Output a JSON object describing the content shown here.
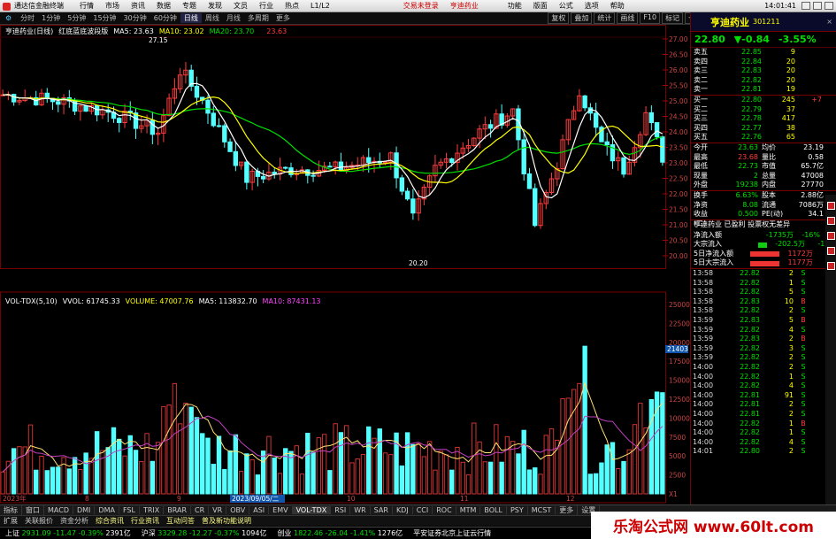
{
  "titlebar": {
    "app": "通达信金融终端",
    "menus": [
      "行情",
      "市场",
      "资讯",
      "数据",
      "专题",
      "发现",
      "文员",
      "行业",
      "热点",
      "L1/L2"
    ],
    "tray_login": "交易未登录",
    "stock": "亨迪药业",
    "right_menus": [
      "功能",
      "版面",
      "公式",
      "选项",
      "帮助"
    ],
    "clock": "14:01:41"
  },
  "toolbar2": {
    "items": [
      "分时",
      "1分钟",
      "5分钟",
      "15分钟",
      "30分钟",
      "60分钟",
      "日线",
      "周线",
      "月线",
      "多周期",
      "更多"
    ],
    "selected": "日线",
    "right": [
      "复权",
      "叠加",
      "统计",
      "画线",
      "F10",
      "标记",
      "-",
      "后退"
    ]
  },
  "kline_info": {
    "name": "亨迪药业(日线)",
    "indicator": "红底蓝底波段版",
    "ma5": "MA5: 23.63",
    "ma10": "MA10: 23.02",
    "ma20": "MA20: 23.70",
    "last": "23.63"
  },
  "vol_info": {
    "name": "VOL-TDX(5,10)",
    "vvol": "VVOL: 61745.33",
    "volume": "VOLUME: 47007.76",
    "ma5": "MA5: 113832.70",
    "ma10": "MA10: 87431.13"
  },
  "axis": {
    "price_ticks": [
      "27.00",
      "26.50",
      "26.00",
      "25.50",
      "25.00",
      "24.50",
      "24.00",
      "23.50",
      "23.00",
      "22.50",
      "22.00",
      "21.50",
      "21.00",
      "20.50",
      "20.00"
    ],
    "vol_ticks": [
      "25000",
      "22500",
      "20000",
      "17500",
      "15000",
      "12500",
      "10000",
      "7500",
      "5000",
      "2500",
      "X1"
    ],
    "vol_marker": "21403",
    "hi_label": "27.15",
    "lo_label": "20.20",
    "date_start": "2023年",
    "date_cursor": "2023/09/05/二",
    "months": [
      "8",
      "9",
      "10",
      "11",
      "12"
    ]
  },
  "quote": {
    "name": "亨迪药业",
    "code": "301211",
    "price": "22.80",
    "change": "▼-0.84",
    "pct": "-3.55%",
    "asks": [
      {
        "label": "卖五",
        "price": "22.85",
        "vol": "9"
      },
      {
        "label": "卖四",
        "price": "22.84",
        "vol": "20"
      },
      {
        "label": "卖三",
        "price": "22.83",
        "vol": "20"
      },
      {
        "label": "卖二",
        "price": "22.82",
        "vol": "20"
      },
      {
        "label": "卖一",
        "price": "22.81",
        "vol": "19"
      }
    ],
    "bids": [
      {
        "label": "买一",
        "price": "22.80",
        "vol": "245",
        "chg": "+7"
      },
      {
        "label": "买二",
        "price": "22.79",
        "vol": "37"
      },
      {
        "label": "买三",
        "price": "22.78",
        "vol": "417"
      },
      {
        "label": "买四",
        "price": "22.77",
        "vol": "38"
      },
      {
        "label": "买五",
        "price": "22.76",
        "vol": "65"
      }
    ],
    "stats": [
      {
        "a": "今开",
        "b": "23.63",
        "c": "均价",
        "d": "23.19"
      },
      {
        "a": "最高",
        "b": "23.68",
        "c": "量比",
        "d": "0.58"
      },
      {
        "a": "最低",
        "b": "22.73",
        "c": "市值",
        "d": "65.7亿"
      },
      {
        "a": "现量",
        "b": "2",
        "c": "总量",
        "d": "47008"
      },
      {
        "a": "外盘",
        "b": "19238",
        "c": "内盘",
        "d": "27770"
      }
    ],
    "stats2": [
      {
        "a": "换手",
        "b": "6.63%",
        "c": "股本",
        "d": "2.88亿"
      },
      {
        "a": "净资",
        "b": "8.08",
        "c": "流通",
        "d": "7086万"
      },
      {
        "a": "收益(二)",
        "b": "0.500",
        "c": "PE(动)",
        "d": "34.1"
      }
    ],
    "ticker": "亨迪药业 已盈利 投票权无差异",
    "flows": [
      {
        "label": "净流入额",
        "bar": 0,
        "val": "-1735万",
        "pct": "-16%",
        "cls": "grn"
      },
      {
        "label": "大宗流入",
        "bar": 10,
        "val": "-202.5万",
        "pct": "-1%",
        "cls": "grn"
      },
      {
        "label": "5日净流入额",
        "bar": 38,
        "val": "1172万",
        "pct": "1%",
        "cls": "red"
      },
      {
        "label": "5日大宗流入",
        "bar": 38,
        "val": "1177万",
        "pct": "1%",
        "cls": "red"
      }
    ],
    "ticks": [
      {
        "t": "13:58",
        "p": "22.82",
        "v": "2",
        "s": "S"
      },
      {
        "t": "13:58",
        "p": "22.82",
        "v": "1",
        "s": "S"
      },
      {
        "t": "13:58",
        "p": "22.82",
        "v": "5",
        "s": "S"
      },
      {
        "t": "13:58",
        "p": "22.83",
        "v": "10",
        "s": "B"
      },
      {
        "t": "13:58",
        "p": "22.82",
        "v": "2",
        "s": "S"
      },
      {
        "t": "13:59",
        "p": "22.83",
        "v": "5",
        "s": "B"
      },
      {
        "t": "13:59",
        "p": "22.82",
        "v": "4",
        "s": "S"
      },
      {
        "t": "13:59",
        "p": "22.83",
        "v": "2",
        "s": "B"
      },
      {
        "t": "13:59",
        "p": "22.82",
        "v": "3",
        "s": "S"
      },
      {
        "t": "13:59",
        "p": "22.82",
        "v": "2",
        "s": "S"
      },
      {
        "t": "14:00",
        "p": "22.82",
        "v": "2",
        "s": "S"
      },
      {
        "t": "14:00",
        "p": "22.82",
        "v": "1",
        "s": "S"
      },
      {
        "t": "14:00",
        "p": "22.82",
        "v": "4",
        "s": "S"
      },
      {
        "t": "14:00",
        "p": "22.81",
        "v": "91",
        "s": "S"
      },
      {
        "t": "14:00",
        "p": "22.81",
        "v": "2",
        "s": "S"
      },
      {
        "t": "14:00",
        "p": "22.81",
        "v": "2",
        "s": "S"
      },
      {
        "t": "14:00",
        "p": "22.82",
        "v": "1",
        "s": "B"
      },
      {
        "t": "14:00",
        "p": "22.82",
        "v": "1",
        "s": "S"
      },
      {
        "t": "14:00",
        "p": "22.82",
        "v": "4",
        "s": "S"
      },
      {
        "t": "14:01",
        "p": "22.80",
        "v": "2",
        "s": "S"
      }
    ]
  },
  "tabs": [
    "指标",
    "窗口",
    "MACD",
    "DMI",
    "DMA",
    "FSL",
    "TRIX",
    "BRAR",
    "CR",
    "VR",
    "OBV",
    "ASI",
    "EMV",
    "VOL-TDX",
    "RSI",
    "WR",
    "SAR",
    "KDJ",
    "CCI",
    "ROC",
    "MTM",
    "BOLL",
    "PSY",
    "MCST",
    "更多",
    "设置"
  ],
  "tab_selected": "VOL-TDX",
  "subtabs": [
    "扩展",
    "关联报价",
    "资金分析",
    "综合资讯",
    "行业资讯",
    "互动问答",
    "普及新功能说明"
  ],
  "status": [
    {
      "label": "上证",
      "val": "2931.09",
      "chg": "-11.47",
      "pct": "-0.39%",
      "amt": "2391亿"
    },
    {
      "label": "沪深",
      "val": "3329.28",
      "chg": "-12.27",
      "pct": "-0.37%",
      "amt": "1094亿"
    },
    {
      "label": "创业",
      "val": "1822.46",
      "chg": "-26.04",
      "pct": "-1.41%",
      "amt": "1276亿"
    }
  ],
  "status_right": "平安证券北京上证云行情",
  "brand": "乐淘公式网 www.60lt.com",
  "colors": {
    "up": "#ff3c3c",
    "down": "#54ffff",
    "ma5": "#ffffff",
    "ma10": "#ffff00",
    "ma20": "#00e000",
    "ma60": "#ff44ff"
  }
}
